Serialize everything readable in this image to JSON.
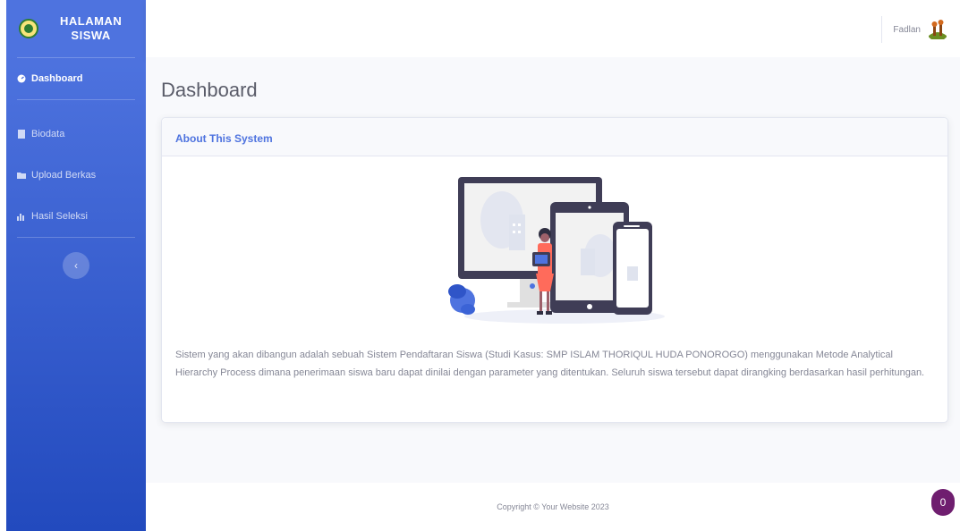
{
  "brand": {
    "line1": "HALAMAN",
    "line2": "SISWA",
    "logo_icon": "school-emblem-icon"
  },
  "sidebar": {
    "items": [
      {
        "label": "Dashboard",
        "icon": "tachometer-icon",
        "active": true
      },
      {
        "label": "Biodata",
        "icon": "document-icon",
        "active": false
      },
      {
        "label": "Upload Berkas",
        "icon": "folder-icon",
        "active": false
      },
      {
        "label": "Hasil Seleksi",
        "icon": "chart-bar-icon",
        "active": false
      }
    ],
    "toggle_glyph": "‹"
  },
  "topbar": {
    "user_name": "Fadlan",
    "avatar_icon": "user-avatar-icon"
  },
  "main": {
    "page_title": "Dashboard",
    "card": {
      "header": "About This System",
      "illustration": "devices-illustration",
      "description": "Sistem yang akan dibangun adalah sebuah Sistem Pendaftaran Siswa (Studi Kasus: SMP ISLAM THORIQUL HUDA PONOROGO) menggunakan Metode Analytical Hierarchy Process dimana penerimaan siswa baru dapat dinilai dengan parameter yang ditentukan. Seluruh siswa tersebut dapat dirangking berdasarkan hasil perhitungan."
    }
  },
  "footer": {
    "copyright": "Copyright © Your Website 2023"
  },
  "badge": {
    "count": "0"
  },
  "colors": {
    "primary": "#4e73df",
    "primary_dark": "#224abe",
    "badge": "#6f1e6f",
    "text_muted": "#858796"
  }
}
